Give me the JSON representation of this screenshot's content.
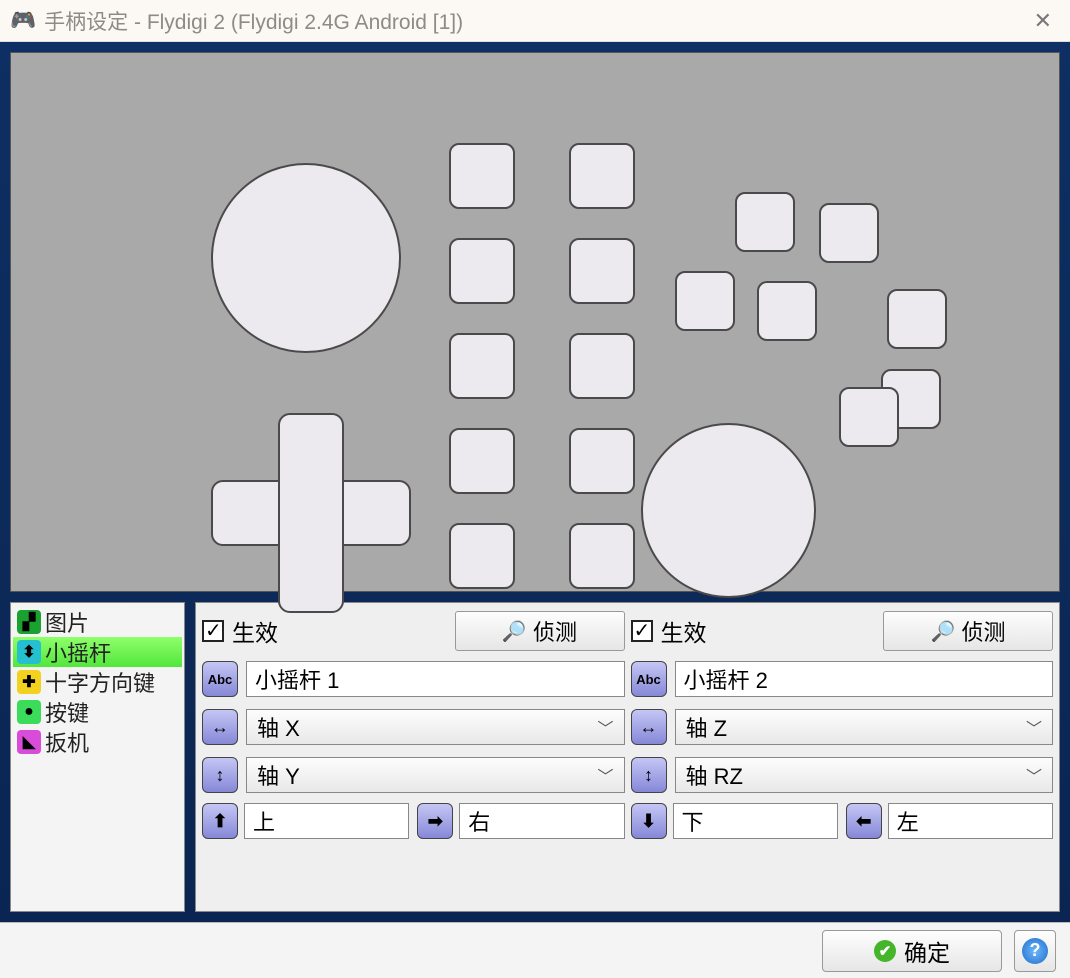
{
  "window": {
    "title": "手柄设定 - Flydigi 2 (Flydigi 2.4G Android [1])"
  },
  "sidebar": {
    "items": [
      {
        "label": "图片"
      },
      {
        "label": "小摇杆"
      },
      {
        "label": "十字方向键"
      },
      {
        "label": "按键"
      },
      {
        "label": "扳机"
      }
    ]
  },
  "panel1": {
    "enable_label": "生效",
    "detect_label": "侦测",
    "name": "小摇杆 1",
    "axis_x": "轴 X",
    "axis_y": "轴 Y",
    "dir1": "上",
    "dir2": "右"
  },
  "panel2": {
    "enable_label": "生效",
    "detect_label": "侦测",
    "name": "小摇杆 2",
    "axis_x": "轴 Z",
    "axis_y": "轴 RZ",
    "dir1": "下",
    "dir2": "左"
  },
  "bottom": {
    "ok_label": "确定"
  }
}
